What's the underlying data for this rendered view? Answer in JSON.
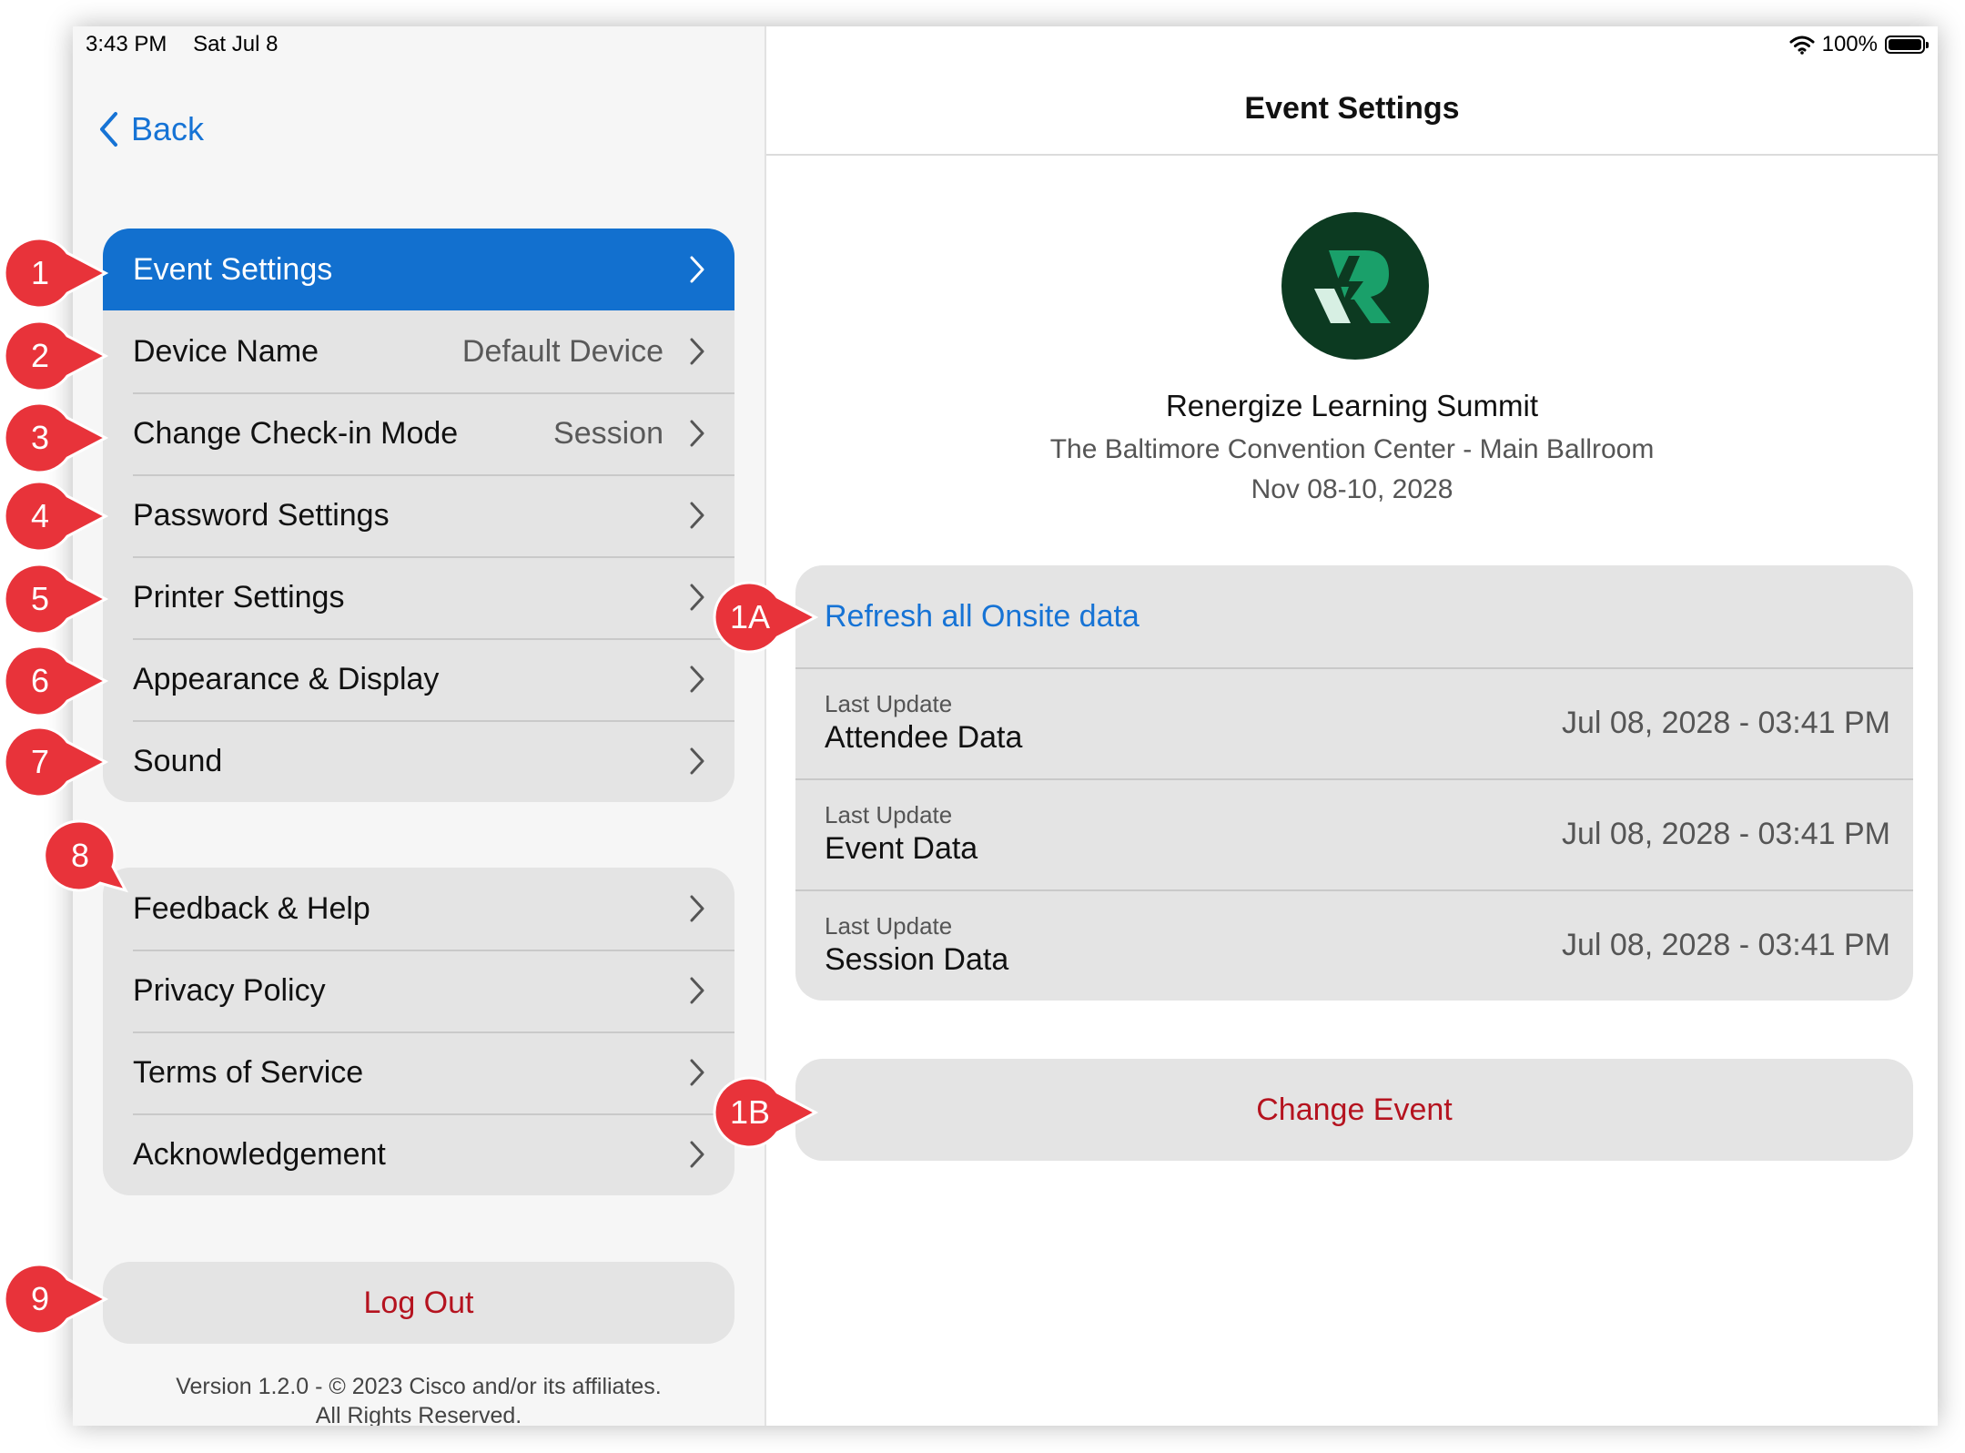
{
  "status_bar": {
    "time": "3:43 PM",
    "date": "Sat Jul 8",
    "battery": "100%",
    "battery_level": 1.0,
    "wifi_icon": "wifi-icon"
  },
  "sidebar": {
    "back_label": "Back",
    "group1": [
      {
        "label": "Event Settings",
        "value": "",
        "active": true
      },
      {
        "label": "Device Name",
        "value": "Default Device"
      },
      {
        "label": "Change Check-in Mode",
        "value": "Session"
      },
      {
        "label": "Password Settings",
        "value": ""
      },
      {
        "label": "Printer Settings",
        "value": ""
      },
      {
        "label": "Appearance & Display",
        "value": ""
      },
      {
        "label": "Sound",
        "value": ""
      }
    ],
    "group2": [
      {
        "label": "Feedback & Help"
      },
      {
        "label": "Privacy Policy"
      },
      {
        "label": "Terms of Service"
      },
      {
        "label": "Acknowledgement"
      }
    ],
    "logout_label": "Log Out",
    "version_line1": "Version 1.2.0 - © 2023 Cisco and/or its affiliates.",
    "version_line2": "All Rights Reserved."
  },
  "main": {
    "title": "Event Settings",
    "event_name": "Renergize Learning Summit",
    "event_venue": "The Baltimore Convention Center - Main Ballroom",
    "event_dates": "Nov 08-10, 2028",
    "refresh_label": "Refresh all Onsite data",
    "updates": [
      {
        "small": "Last Update",
        "big": "Attendee Data",
        "time": "Jul 08, 2028 - 03:41 PM"
      },
      {
        "small": "Last Update",
        "big": "Event Data",
        "time": "Jul 08, 2028 - 03:41 PM"
      },
      {
        "small": "Last Update",
        "big": "Session Data",
        "time": "Jul 08, 2028 - 03:41 PM"
      }
    ],
    "change_event_label": "Change Event"
  },
  "callouts": [
    "1",
    "2",
    "3",
    "4",
    "5",
    "6",
    "7",
    "8",
    "9",
    "1A",
    "1B"
  ],
  "colors": {
    "accent": "#1270cf",
    "link": "#1673d5",
    "destructive": "#b5131f",
    "callout": "#e8333a",
    "logo_bg": "#0c3a21",
    "logo_mark": "#1aa06a"
  }
}
